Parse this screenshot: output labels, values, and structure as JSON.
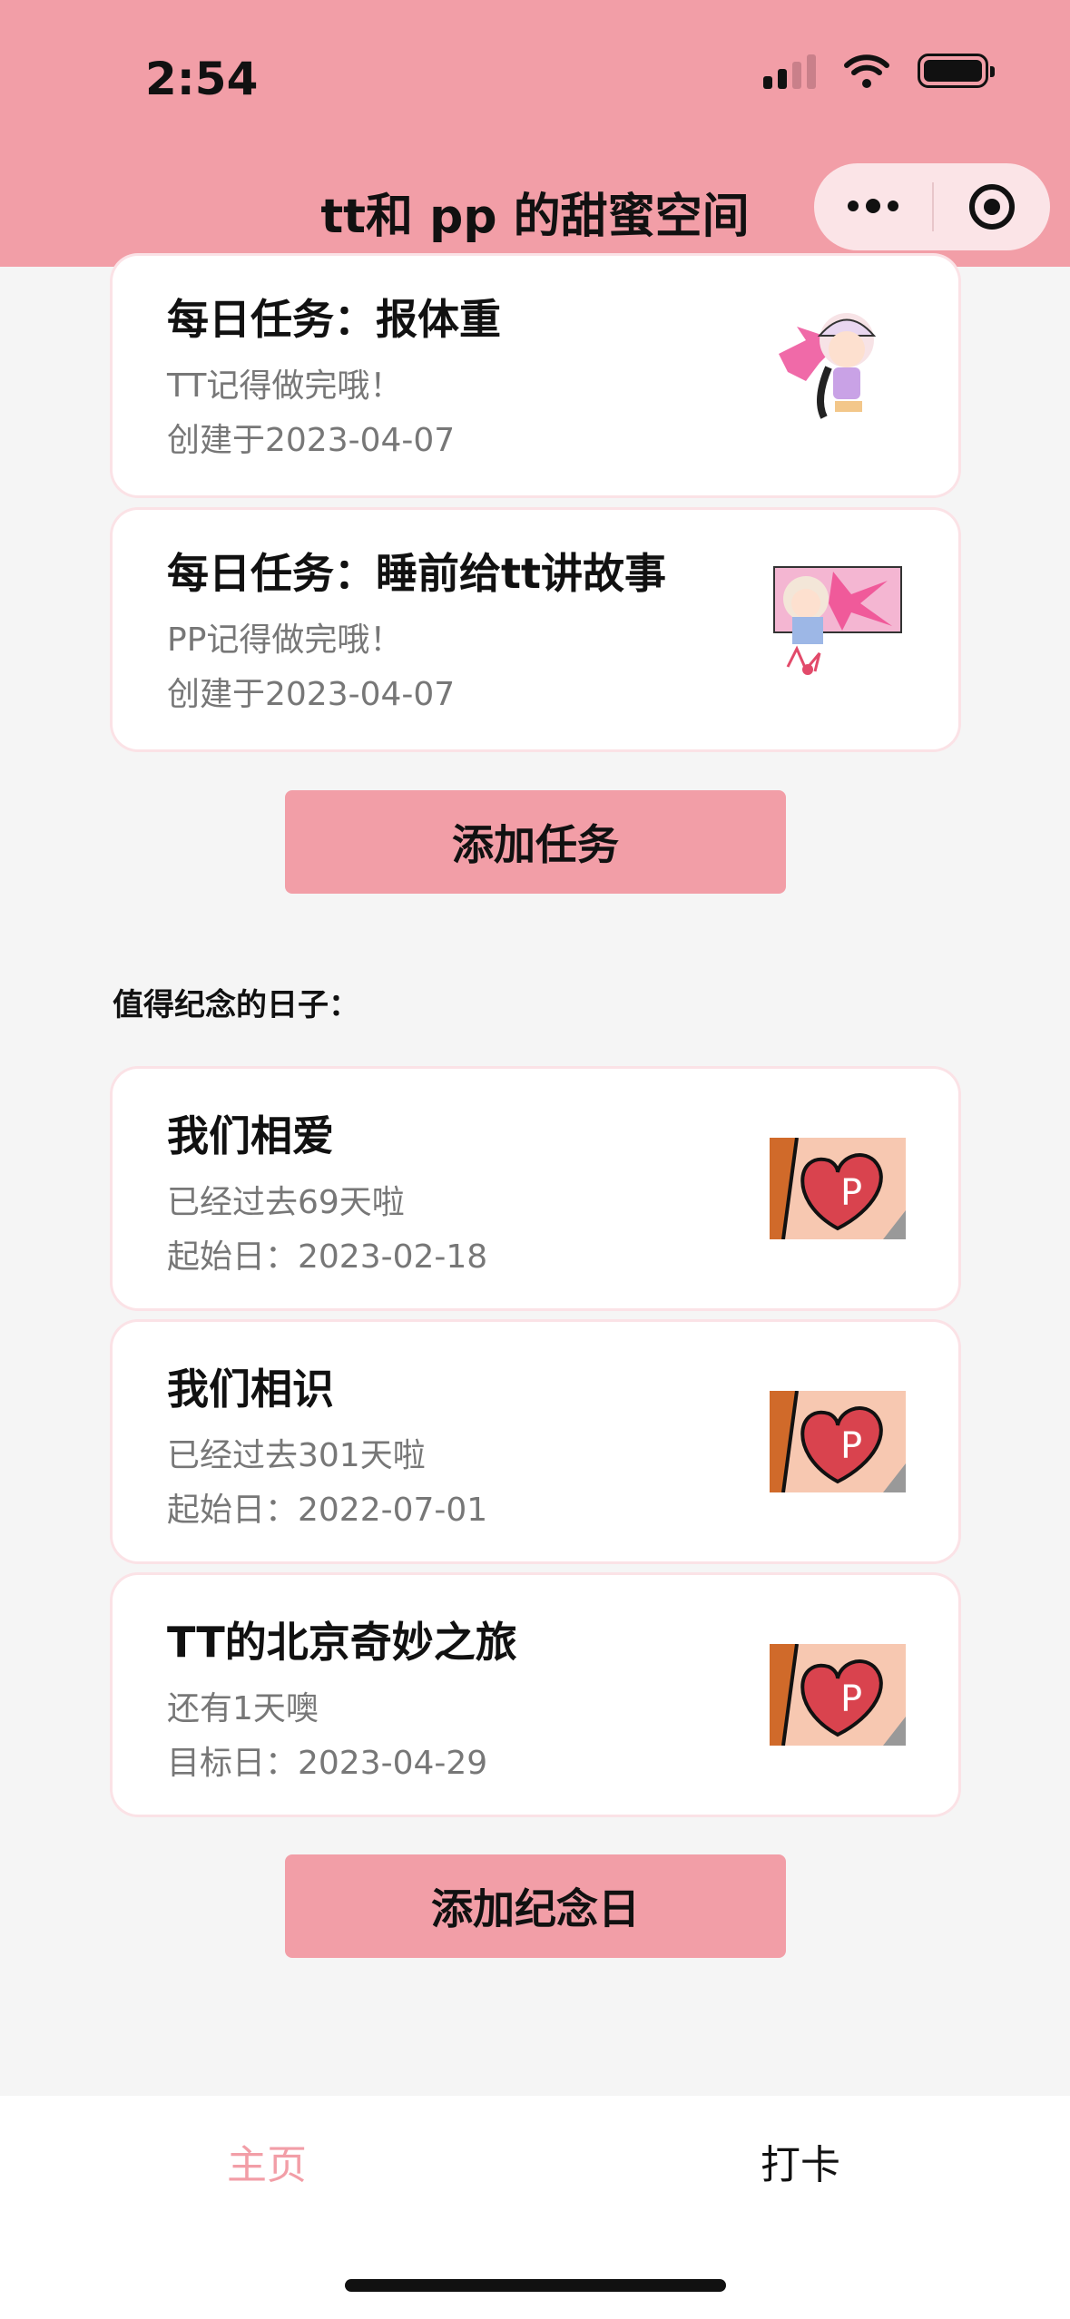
{
  "status_bar": {
    "time": "2:54"
  },
  "nav": {
    "title": "tt和 pp 的甜蜜空间"
  },
  "tasks": [
    {
      "title": "每日任务：报体重",
      "subtitle": "TT记得做完哦！",
      "date": "创建于2023-04-07",
      "image": "girl-sticker-1"
    },
    {
      "title": "每日任务：睡前给tt讲故事",
      "subtitle": "PP记得做完哦！",
      "date": "创建于2023-04-07",
      "image": "girl-sticker-2"
    }
  ],
  "add_task_label": "添加任务",
  "anniversary_section_label": "值得纪念的日子：",
  "anniversaries": [
    {
      "title": "我们相爱",
      "subtitle": "已经过去69天啦",
      "date": "起始日：2023-02-18",
      "image": "heart-p-icon"
    },
    {
      "title": "我们相识",
      "subtitle": "已经过去301天啦",
      "date": "起始日：2022-07-01",
      "image": "heart-p-icon"
    },
    {
      "title": "TT的北京奇妙之旅",
      "subtitle": "还有1天噢",
      "date": "目标日：2023-04-29",
      "image": "heart-p-icon"
    }
  ],
  "add_anniversary_label": "添加纪念日",
  "tabbar": {
    "home": "主页",
    "checkin": "打卡"
  },
  "colors": {
    "accent": "#f29ea7",
    "background": "#f5f5f5",
    "card": "#ffffff",
    "muted_text": "#777777"
  }
}
